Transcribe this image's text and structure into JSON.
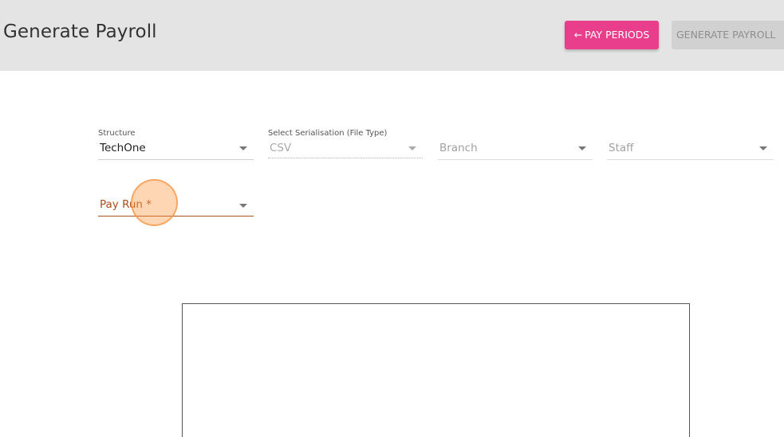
{
  "header": {
    "title": "Generate Payroll",
    "pay_periods_button": {
      "arrow": "←",
      "label": "PAY PERIODS"
    },
    "generate_button": {
      "label": "GENERATE PAYROLL"
    }
  },
  "form": {
    "structure": {
      "label": "Structure",
      "value": "TechOne"
    },
    "serialisation": {
      "label": "Select Serialisation (File Type)",
      "value": "CSV"
    },
    "branch": {
      "placeholder": "Branch"
    },
    "staff": {
      "placeholder": "Staff"
    },
    "pay_run": {
      "placeholder": "Pay Run *"
    }
  },
  "colors": {
    "header_bg": "#e4e4e4",
    "accent_pink": "#e83e8c",
    "disabled_button_bg": "#d1d1d1",
    "error_orange": "#a94e1d"
  }
}
